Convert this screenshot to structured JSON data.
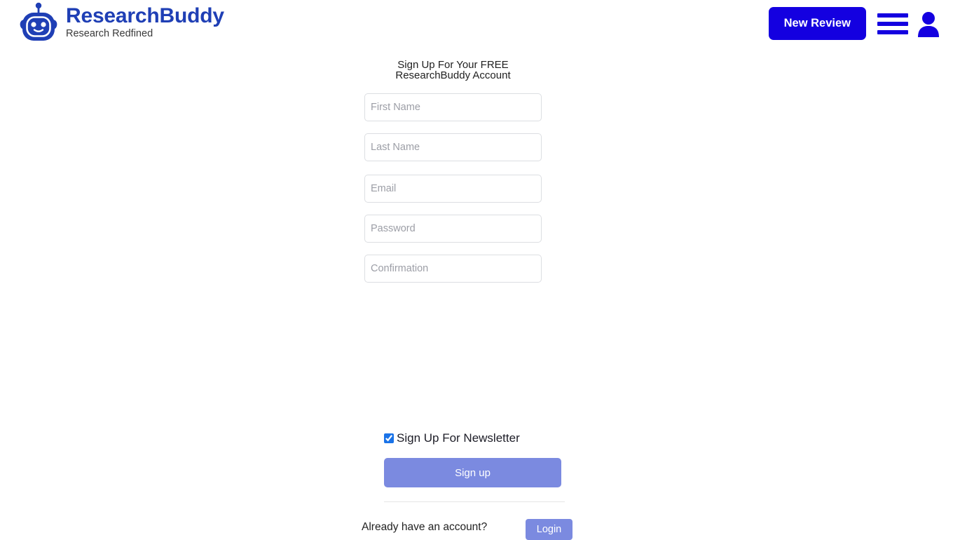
{
  "brand": {
    "name": "ResearchBuddy",
    "tagline": "Research Redfined",
    "logo_icon": "robot-head-icon",
    "name_color": "#1f3fb5"
  },
  "header": {
    "new_review_label": "New Review",
    "new_review_color": "#1400e0",
    "menu_icon": "hamburger-menu-icon",
    "account_icon": "user-avatar-icon"
  },
  "signup": {
    "heading_line1": "Sign Up For Your FREE",
    "heading_line2": "ResearchBuddy Account",
    "fields": {
      "first_name_placeholder": "First Name",
      "last_name_placeholder": "Last Name",
      "email_placeholder": "Email",
      "password_placeholder": "Password",
      "confirmation_placeholder": "Confirmation",
      "first_name_value": "",
      "last_name_value": "",
      "email_value": "",
      "password_value": "",
      "confirmation_value": ""
    },
    "newsletter_label": "Sign Up For Newsletter",
    "newsletter_checked": true,
    "submit_label": "Sign up",
    "submit_color": "#7b8ae0",
    "already_account_text": "Already have an account?",
    "login_label": "Login",
    "login_color": "#7b8ae0"
  }
}
